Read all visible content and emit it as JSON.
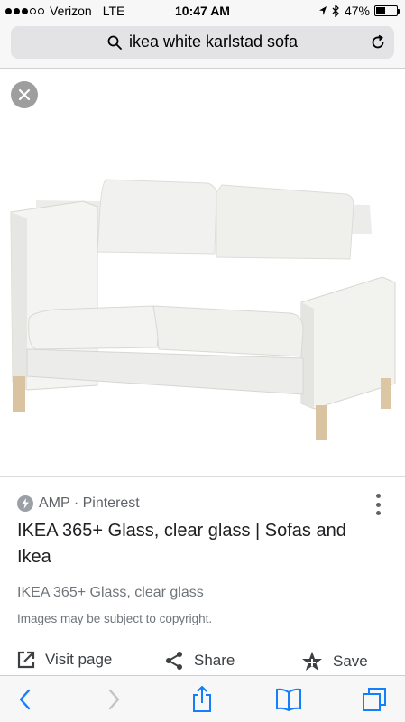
{
  "status_bar": {
    "carrier": "Verizon",
    "network": "LTE",
    "time": "10:47 AM",
    "battery": "47%",
    "battery_level": 0.47
  },
  "address_bar": {
    "query": "ikea white karlstad sofa"
  },
  "result": {
    "source": "AMP · Pinterest",
    "title": "IKEA 365+ Glass, clear glass | Sofas and Ikea",
    "description": "IKEA 365+ Glass, clear glass",
    "copyright": "Images may be subject to copyright."
  },
  "actions": {
    "visit_label": "Visit page",
    "share_label": "Share",
    "save_label": "Save"
  },
  "icons": {
    "close": "close-icon",
    "search": "search-icon",
    "reload": "reload-icon",
    "more": "more-vert-icon",
    "back": "back-icon",
    "forward": "forward-icon",
    "share": "share-icon",
    "bookmarks": "bookmarks-icon",
    "tabs": "tabs-icon"
  },
  "colors": {
    "accent": "#1a73e8",
    "ios_blue": "#147efb",
    "text_primary": "#202124",
    "text_secondary": "#70757a"
  }
}
